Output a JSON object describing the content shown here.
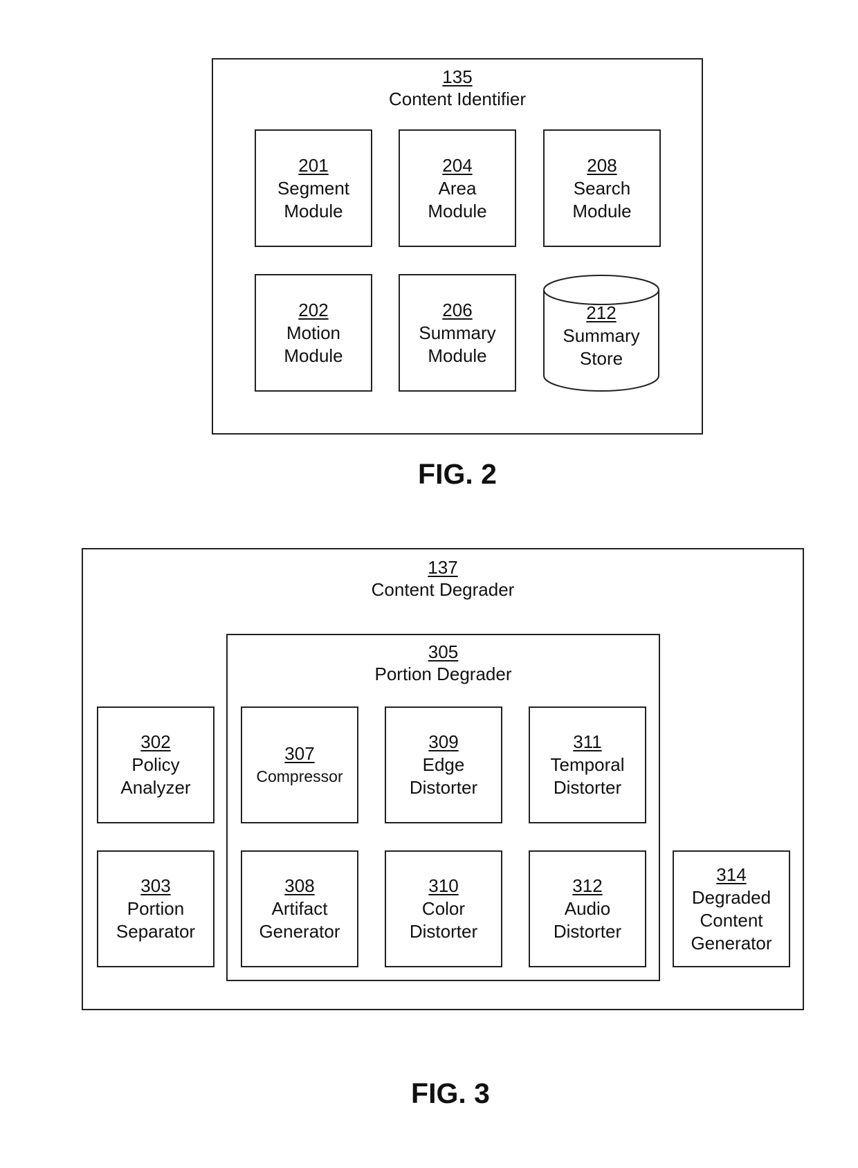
{
  "fig2": {
    "label": "FIG. 2",
    "container": {
      "ref": "135",
      "name": "Content Identifier"
    },
    "modules": [
      {
        "ref": "201",
        "lines": [
          "Segment",
          "Module"
        ]
      },
      {
        "ref": "204",
        "lines": [
          "Area",
          "Module"
        ]
      },
      {
        "ref": "208",
        "lines": [
          "Search",
          "Module"
        ]
      },
      {
        "ref": "202",
        "lines": [
          "Motion",
          "Module"
        ]
      },
      {
        "ref": "206",
        "lines": [
          "Summary",
          "Module"
        ]
      }
    ],
    "store": {
      "ref": "212",
      "lines": [
        "Summary",
        "Store"
      ]
    }
  },
  "fig3": {
    "label": "FIG. 3",
    "container": {
      "ref": "137",
      "name": "Content Degrader"
    },
    "sub_container": {
      "ref": "305",
      "name": "Portion Degrader"
    },
    "modules": [
      {
        "ref": "302",
        "lines": [
          "Policy",
          "Analyzer"
        ]
      },
      {
        "ref": "303",
        "lines": [
          "Portion",
          "Separator"
        ]
      },
      {
        "ref": "307",
        "lines": [
          "Compressor"
        ]
      },
      {
        "ref": "309",
        "lines": [
          "Edge",
          "Distorter"
        ]
      },
      {
        "ref": "311",
        "lines": [
          "Temporal",
          "Distorter"
        ]
      },
      {
        "ref": "308",
        "lines": [
          "Artifact",
          "Generator"
        ]
      },
      {
        "ref": "310",
        "lines": [
          "Color",
          "Distorter"
        ]
      },
      {
        "ref": "312",
        "lines": [
          "Audio",
          "Distorter"
        ]
      },
      {
        "ref": "314",
        "lines": [
          "Degraded",
          "Content",
          "Generator"
        ]
      }
    ]
  }
}
